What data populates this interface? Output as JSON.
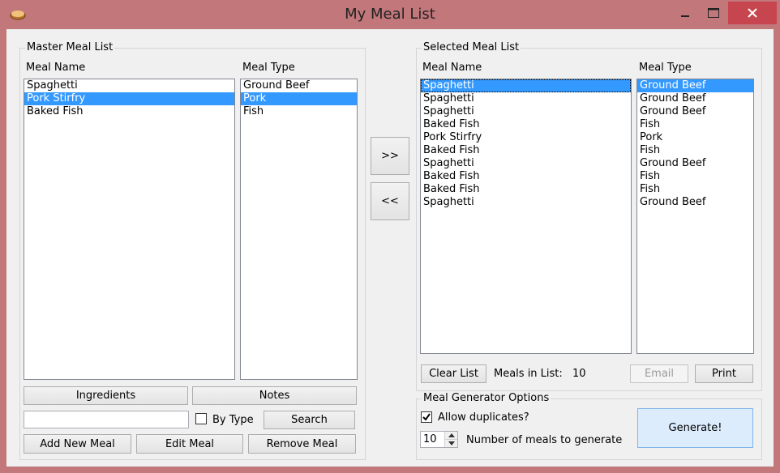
{
  "window": {
    "title": "My Meal List",
    "accent_color": "#c2777b",
    "close_color": "#c7454f"
  },
  "master": {
    "group_label": "Master Meal List",
    "col_name": "Meal Name",
    "col_type": "Meal Type",
    "names": [
      "Spaghetti",
      "Pork Stirfry",
      "Baked Fish"
    ],
    "types": [
      "Ground Beef",
      "Pork",
      "Fish"
    ],
    "selected_index": 1
  },
  "transfer": {
    "add_label": ">>",
    "remove_label": "<<"
  },
  "selected": {
    "group_label": "Selected Meal List",
    "col_name": "Meal Name",
    "col_type": "Meal Type",
    "names": [
      "Spaghetti",
      "Spaghetti",
      "Spaghetti",
      "Baked Fish",
      "Pork Stirfry",
      "Baked Fish",
      "Spaghetti",
      "Baked Fish",
      "Baked Fish",
      "Spaghetti"
    ],
    "types": [
      "Ground Beef",
      "Ground Beef",
      "Ground Beef",
      "Fish",
      "Pork",
      "Fish",
      "Ground Beef",
      "Fish",
      "Fish",
      "Ground Beef"
    ],
    "selected_index": 0,
    "clear_label": "Clear List",
    "count_label": "Meals in List:",
    "count_value": "10",
    "email_label": "Email",
    "print_label": "Print"
  },
  "master_actions": {
    "ingredients_label": "Ingredients",
    "notes_label": "Notes",
    "search_value": "",
    "by_type_label": "By Type",
    "by_type_checked": false,
    "search_label": "Search",
    "add_label": "Add New Meal",
    "edit_label": "Edit Meal",
    "remove_label": "Remove Meal"
  },
  "generator": {
    "group_label": "Meal Generator Options",
    "allow_duplicates_label": "Allow duplicates?",
    "allow_duplicates_checked": true,
    "count_value": "10",
    "count_label": "Number of meals to generate",
    "generate_label": "Generate!"
  },
  "colors": {
    "selection": "#3399ff",
    "generate_bg": "#dcecfc"
  }
}
